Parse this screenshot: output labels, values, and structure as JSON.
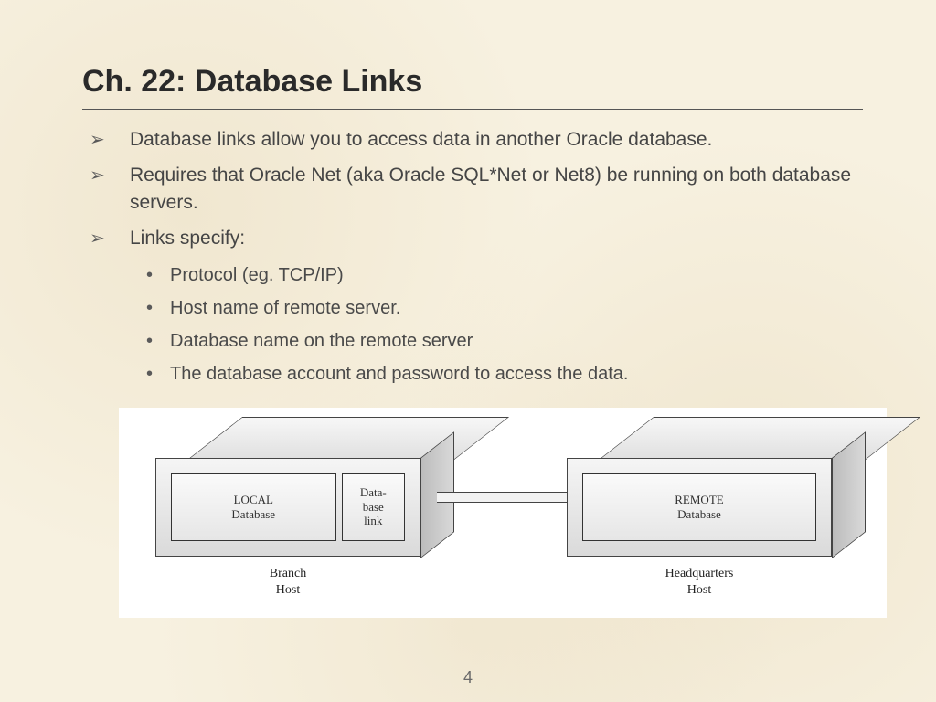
{
  "title": "Ch. 22: Database Links",
  "bullets": {
    "b1": "Database links allow you to access data in another Oracle database.",
    "b2": "Requires that Oracle Net (aka Oracle SQL*Net or Net8) be running on both database servers.",
    "b3": "Links specify:"
  },
  "sub": {
    "s1": "Protocol (eg. TCP/IP)",
    "s2": "Host name of remote server.",
    "s3": "Database name on the remote server",
    "s4": "The database account and password to access the data."
  },
  "diagram": {
    "local_panel": "LOCAL\nDatabase",
    "link_panel": "Data-\nbase\nlink",
    "remote_panel": "REMOTE\nDatabase",
    "branch_label": "Branch\nHost",
    "hq_label": "Headquarters\nHost"
  },
  "page_number": "4"
}
